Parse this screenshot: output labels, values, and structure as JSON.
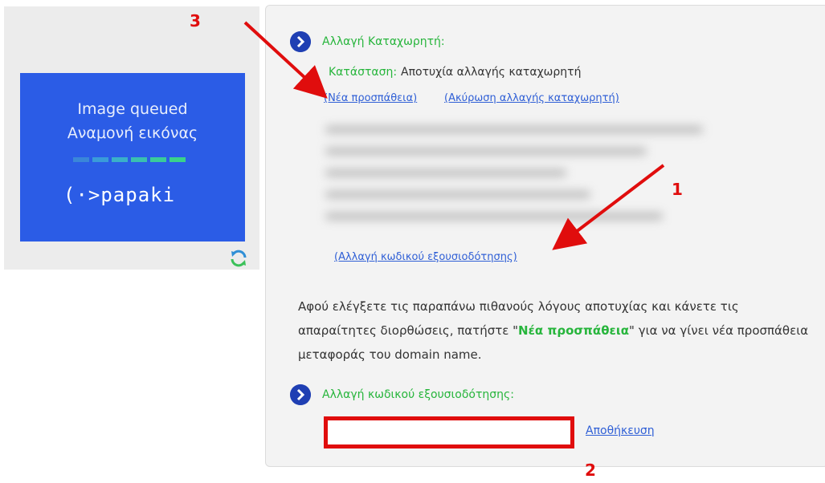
{
  "thumbnail": {
    "line1": "Image queued",
    "line2": "Αναμονή εικόνας",
    "brand": "(·>papaki",
    "progress_colors": [
      "#3a86d9",
      "#3a9bd9",
      "#3ab0c9",
      "#3ac0b0",
      "#3acb9a",
      "#3ad28a"
    ]
  },
  "registrar_change": {
    "title": "Αλλαγή Καταχωρητή:",
    "status_label": "Κατάσταση:",
    "status_value": "Αποτυχία αλλαγής καταχωρητή",
    "retry_link": "(Νέα προσπάθεια)",
    "cancel_link": "(Ακύρωση αλλαγής καταχωρητή)",
    "change_authcode_link": "(Αλλαγή κωδικού εξουσιοδότησης)"
  },
  "instructions": {
    "before": "Αφού ελέγξετε τις παραπάνω πιθανούς λόγους αποτυχίας και κάνετε τις απαραίτητες διορθώσεις, πατήστε \"",
    "highlight": "Νέα προσπάθεια",
    "after": "\" για να γίνει νέα προσπάθεια μεταφοράς του domain name."
  },
  "authcode_section": {
    "title": "Αλλαγή κωδικού εξουσιοδότησης:",
    "input_value": "",
    "save_label": "Αποθήκευση"
  },
  "annotations": {
    "one": "1",
    "two": "2",
    "three": "3"
  },
  "colors": {
    "accent_green": "#27b53c",
    "link_blue": "#2f5fd6",
    "annotation_red": "#e00d0d",
    "thumb_blue": "#2b5ce6"
  }
}
